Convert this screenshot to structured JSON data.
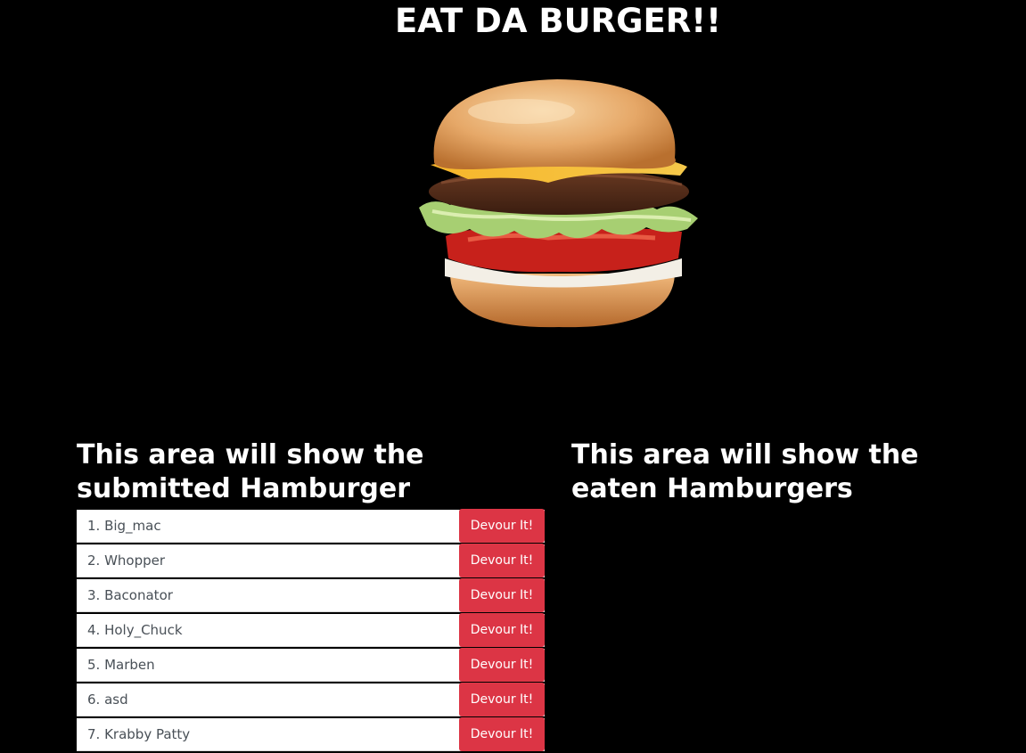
{
  "page": {
    "title": "EAT DA BURGER!!"
  },
  "hero": {
    "image": "burger-illustration"
  },
  "submitted": {
    "heading": "This area will show the submitted Hamburger",
    "button_label": "Devour It!",
    "items": [
      {
        "label": "1. Big_mac"
      },
      {
        "label": "2. Whopper"
      },
      {
        "label": "3. Baconator"
      },
      {
        "label": "4. Holy_Chuck"
      },
      {
        "label": "5. Marben"
      },
      {
        "label": "6. asd"
      },
      {
        "label": "7. Krabby Patty"
      }
    ]
  },
  "eaten": {
    "heading": "This area will show the eaten Hamburgers"
  },
  "colors": {
    "background": "#000000",
    "button": "#dc3545",
    "item_text": "#495057"
  }
}
